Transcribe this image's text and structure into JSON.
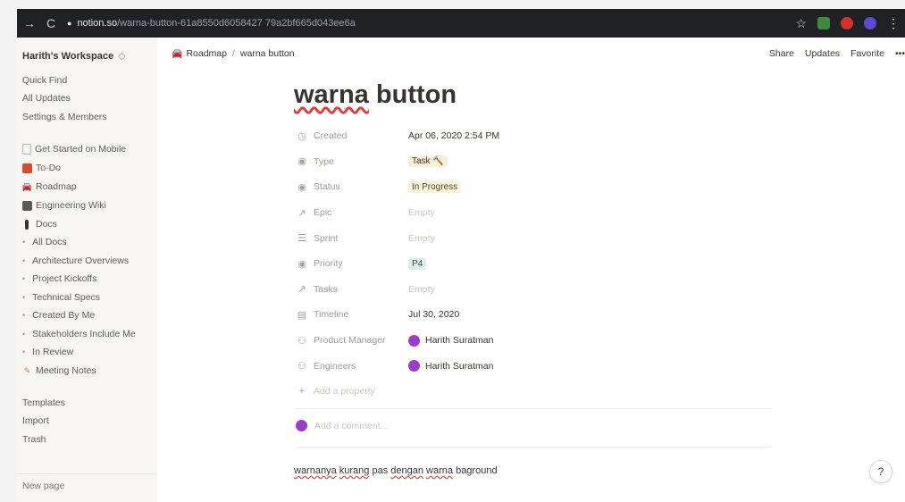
{
  "browser": {
    "domain": "notion.so",
    "path": "/warna-button-61a8550d6058427 79a2bf665d043ee6a",
    "back_icon": "arrow-right-icon",
    "reload_icon": "reload-icon"
  },
  "sidebar": {
    "workspace": "Harith's Workspace",
    "workspace_chevron": "◇",
    "top_items": [
      "Quick Find",
      "All Updates",
      "Settings & Members"
    ],
    "pages": [
      {
        "label": "Get Started on Mobile",
        "icon": "page-icon"
      },
      {
        "label": "To-Do",
        "icon": "todo-icon"
      },
      {
        "label": "Roadmap",
        "icon": "car-icon"
      },
      {
        "label": "Engineering Wiki",
        "icon": "wiki-icon"
      },
      {
        "label": "Docs",
        "icon": "docs-icon"
      }
    ],
    "doc_items": [
      "All Docs",
      "Architecture Overviews",
      "Project Kickoffs",
      "Technical Specs",
      "Created By Me",
      "Stakeholders Include Me",
      "In Review"
    ],
    "meeting_notes": "Meeting Notes",
    "bottom_items": [
      "Templates",
      "Import",
      "Trash"
    ],
    "new_page": "New page"
  },
  "topbar": {
    "breadcrumb_parent": "Roadmap",
    "breadcrumb_sep": "/",
    "breadcrumb_current": "warna button",
    "share": "Share",
    "updates": "Updates",
    "favorite": "Favorite",
    "more": "•••"
  },
  "page": {
    "title_word1": "warna",
    "title_word2": " button",
    "properties": [
      {
        "key": "Created",
        "icon": "clock-icon",
        "value": "Apr 06, 2020 2:54 PM",
        "kind": "text"
      },
      {
        "key": "Type",
        "icon": "select-icon",
        "value": "Task 🔨",
        "kind": "tag-task"
      },
      {
        "key": "Status",
        "icon": "select-icon",
        "value": "In Progress",
        "kind": "tag-progress"
      },
      {
        "key": "Epic",
        "icon": "relation-icon",
        "value": "Empty",
        "kind": "empty"
      },
      {
        "key": "Sprint",
        "icon": "list-icon",
        "value": "Empty",
        "kind": "empty"
      },
      {
        "key": "Priority",
        "icon": "select-icon",
        "value": "P4",
        "kind": "tag-p4"
      },
      {
        "key": "Tasks",
        "icon": "relation-icon",
        "value": "Empty",
        "kind": "empty"
      },
      {
        "key": "Timeline",
        "icon": "calendar-icon",
        "value": "Jul 30, 2020",
        "kind": "text"
      },
      {
        "key": "Product Manager",
        "icon": "person-icon",
        "value": "Harith Suratman",
        "kind": "person"
      },
      {
        "key": "Engineers",
        "icon": "person-icon",
        "value": "Harith Suratman",
        "kind": "person"
      }
    ],
    "add_property": "Add a property",
    "add_comment": "Add a comment...",
    "body_words": [
      "warnanya",
      " ",
      "kurang",
      " pas ",
      "dengan",
      " ",
      "warna",
      " baground"
    ]
  },
  "colors": {
    "avatar": "#9d3cc9",
    "tag_task": "#fbedd6",
    "tag_progress": "#fbf3db",
    "tag_p4": "#ddedea"
  },
  "help": "?"
}
